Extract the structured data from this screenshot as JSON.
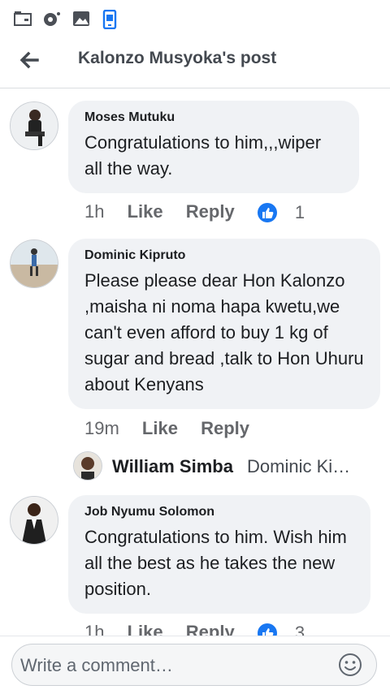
{
  "header": {
    "title": "Kalonzo Musyoka's post"
  },
  "comments": [
    {
      "author": "Moses Mutuku",
      "text": "Congratulations to him,,,wiper all the way.",
      "time": "1h",
      "like": "Like",
      "reply": "Reply",
      "reactions": "1"
    },
    {
      "author": "Dominic Kipruto",
      "text": "Please please dear Hon Kalonzo ,maisha ni noma hapa kwetu,we can't even afford to buy 1 kg of sugar and bread ,talk to Hon Uhuru about Kenyans",
      "time": "19m",
      "like": "Like",
      "reply": "Reply"
    },
    {
      "author": "Job Nyumu Solomon",
      "text": "Congratulations to him. Wish him all the best as he takes the new position.",
      "time": "1h",
      "like": "Like",
      "reply": "Reply",
      "reactions": "3"
    }
  ],
  "reply_preview": {
    "name": "William Simba",
    "text": "Dominic Ki…"
  },
  "composer": {
    "placeholder": "Write a comment…"
  },
  "icons": [
    "tray-icon",
    "radio-icon",
    "image-icon",
    "phone-icon",
    "back-arrow-icon",
    "like-icon",
    "smiley-icon"
  ],
  "colors": {
    "like_blue": "#1877f2",
    "bubble": "#f0f2f5"
  }
}
